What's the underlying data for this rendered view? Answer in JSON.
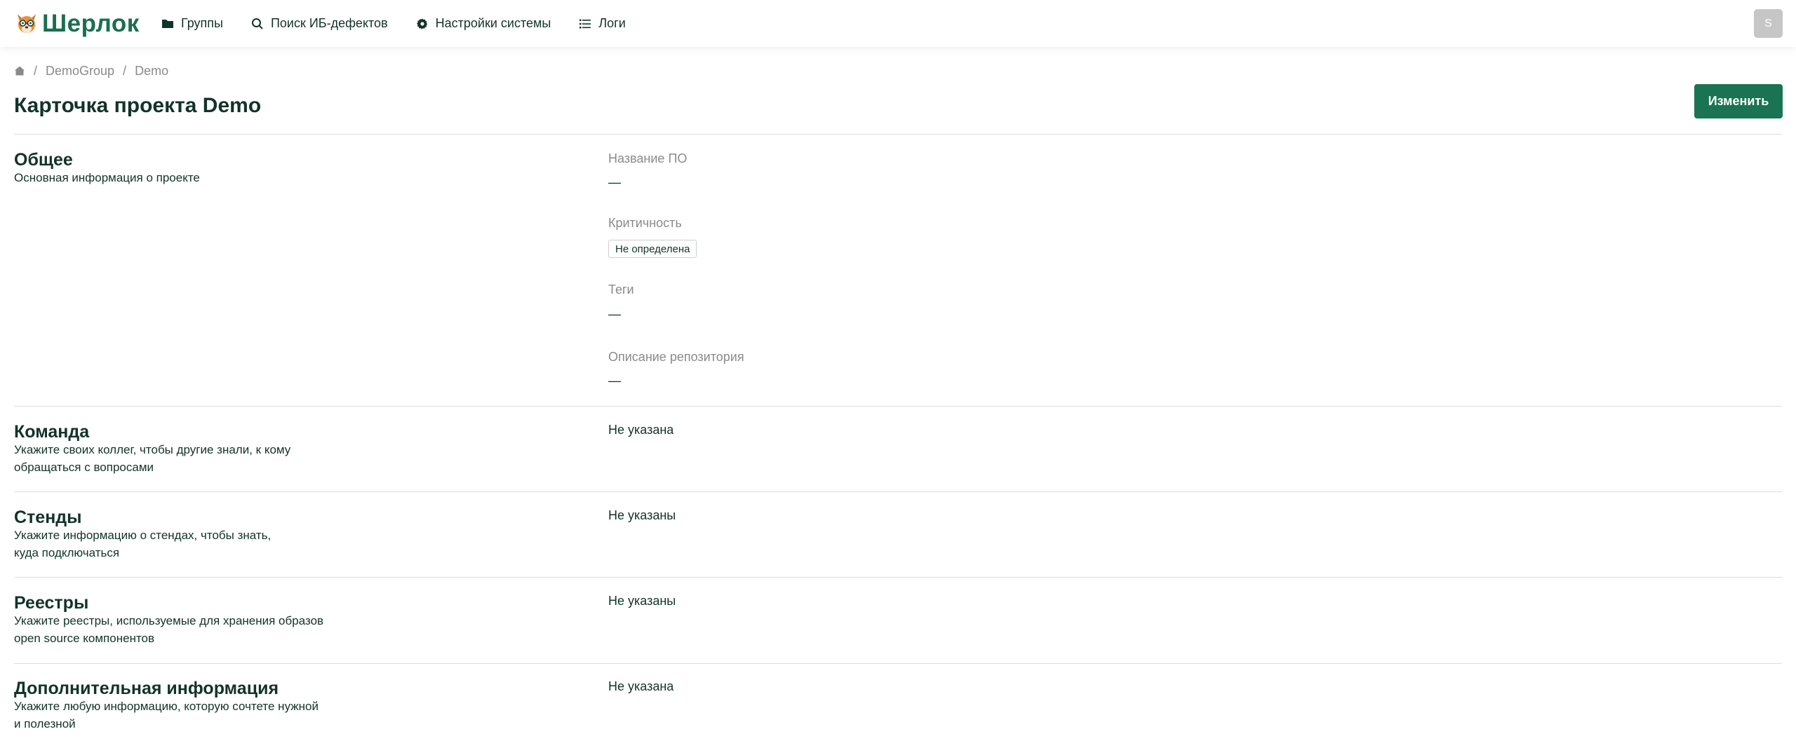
{
  "brand": {
    "name": "Шерлок",
    "logo_icon": "dog-logo-icon",
    "color": "#1a6f50"
  },
  "nav": [
    {
      "label": "Группы",
      "icon": "folder-icon"
    },
    {
      "label": "Поиск ИБ-дефектов",
      "icon": "search-icon"
    },
    {
      "label": "Настройки системы",
      "icon": "gear-icon"
    },
    {
      "label": "Логи",
      "icon": "list-icon"
    }
  ],
  "user": {
    "avatar_letter": "S"
  },
  "breadcrumb": {
    "items": [
      "DemoGroup",
      "Demo"
    ],
    "separator": "/"
  },
  "page": {
    "title": "Карточка проекта Demo",
    "edit_label": "Изменить",
    "accent": "#1a7353"
  },
  "sections": {
    "general": {
      "title": "Общее",
      "desc": "Основная информация о проекте",
      "fields": {
        "software_name_label": "Название ПО",
        "software_name_value": "—",
        "criticality_label": "Критичность",
        "criticality_value": "Не определена",
        "tags_label": "Теги",
        "tags_value": "—",
        "repo_desc_label": "Описание репозитория",
        "repo_desc_value": "—"
      }
    },
    "team": {
      "title": "Команда",
      "desc_line1": "Укажите своих коллег, чтобы другие знали, к кому",
      "desc_line2": "обращаться с вопросами",
      "value": "Не указана"
    },
    "stands": {
      "title": "Стенды",
      "desc_line1": "Укажите информацию о стендах, чтобы знать,",
      "desc_line2": "куда подключаться",
      "value": "Не указаны"
    },
    "registries": {
      "title": "Реестры",
      "desc_line1": "Укажите реестры, используемые для хранения образов",
      "desc_line2": "open source компонентов",
      "value": "Не указаны"
    },
    "additional": {
      "title": "Дополнительная информация",
      "desc_line1": "Укажите любую информацию, которую сочтете нужной",
      "desc_line2": "и полезной",
      "value": "Не указана"
    }
  }
}
